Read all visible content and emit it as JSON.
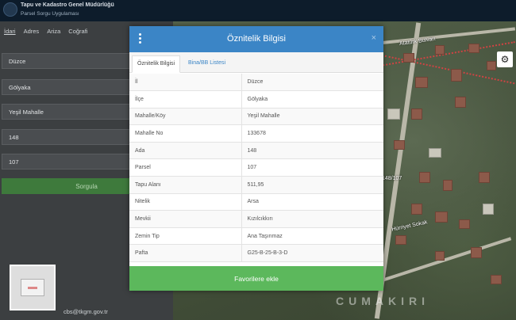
{
  "header": {
    "title": "Tapu ve Kadastro Genel Müdürlüğü",
    "subtitle": "Parsel Sorgu Uygulaması"
  },
  "left_panel": {
    "tabs": [
      {
        "label": "İdari",
        "active": true
      },
      {
        "label": "Adres",
        "active": false
      },
      {
        "label": "Ariza",
        "active": false
      },
      {
        "label": "Coğrafi",
        "active": false
      }
    ],
    "fields": {
      "il": "Düzce",
      "ilce": "Gölyaka",
      "mahalle": "Yeşil Mahalle",
      "ada": "148",
      "parsel": "107"
    },
    "query_button": "Sorgula",
    "email": "cbs@tkgm.gov.tr"
  },
  "map": {
    "label_parcel": "148/107",
    "label_street": "Hürriyet Sokak",
    "label_place": "CUMAKIRI",
    "label_road": "Atatürk Bulvarı"
  },
  "modal": {
    "title": "Öznitelik Bilgisi",
    "close_symbol": "×",
    "tabs": [
      {
        "label": "Öznitelik Bilgisi",
        "active": true
      },
      {
        "label": "Bina/BB Listesi",
        "active": false
      }
    ],
    "rows": [
      {
        "key": "İl",
        "value": "Düzce"
      },
      {
        "key": "İlçe",
        "value": "Gölyaka"
      },
      {
        "key": "Mahalle/Köy",
        "value": "Yeşil Mahalle"
      },
      {
        "key": "Mahalle No",
        "value": "133678"
      },
      {
        "key": "Ada",
        "value": "148"
      },
      {
        "key": "Parsel",
        "value": "107"
      },
      {
        "key": "Tapu Alanı",
        "value": "511,95"
      },
      {
        "key": "Nitelik",
        "value": "Arsa"
      },
      {
        "key": "Mevkii",
        "value": "Kızılcıkkırı"
      },
      {
        "key": "Zemin Tip",
        "value": "Ana Taşınmaz"
      },
      {
        "key": "Pafta",
        "value": "G25-B-25-B-3-D"
      }
    ],
    "favorite_button": "Favorilere ekle"
  },
  "colors": {
    "modal_header": "#3b85c6",
    "favorite_button": "#5cb85c",
    "query_button": "#3e7a3c"
  }
}
